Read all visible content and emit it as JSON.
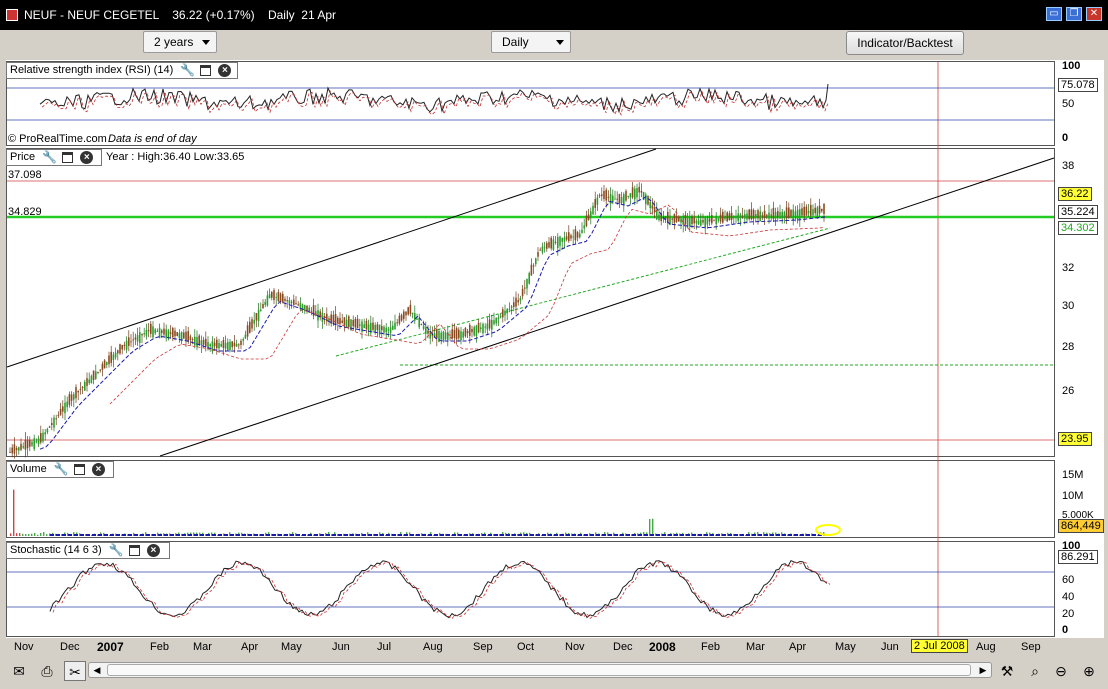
{
  "window": {
    "title": "NEUF - NEUF CEGETEL    36.22 (+0.17%)    Daily  21 Apr",
    "buttons": [
      "▭",
      "❐",
      "✕"
    ]
  },
  "toolbar": {
    "period_select": "2 years",
    "interval_select": "Daily",
    "indicator_button": "Indicator/Backtest"
  },
  "rsi_panel": {
    "header": "Relative strength index (RSI) (14)",
    "y_ticks": [
      "100",
      "50",
      "0"
    ],
    "current_value": "75.078",
    "footer_brand": "© ProRealTime.com",
    "footer_note": "Data is end of day"
  },
  "price_panel": {
    "header": "Price",
    "info": "Year : High:36.40 Low:33.65",
    "y_ticks": [
      "38",
      "36",
      "34",
      "32",
      "30",
      "28",
      "26"
    ],
    "left_labels": [
      "37.098",
      "34.829"
    ],
    "last_price": "36.22",
    "ma_value": "35.224",
    "support_value": "34.302",
    "low_value": "23.95"
  },
  "volume_panel": {
    "header": "Volume",
    "y_ticks": [
      "15M",
      "10M",
      "5.000K"
    ],
    "current_value": "864,449"
  },
  "stochastic_panel": {
    "header": "Stochastic (14 6 3)",
    "y_ticks": [
      "100",
      "80",
      "60",
      "40",
      "20",
      "0"
    ],
    "current_value": "86.291"
  },
  "x_axis": {
    "labels": [
      "Nov",
      "Dec",
      "2007",
      "Feb",
      "Mar",
      "Apr",
      "May",
      "Jun",
      "Jul",
      "Aug",
      "Sep",
      "Oct",
      "Nov",
      "Dec",
      "2008",
      "Feb",
      "Mar",
      "Apr",
      "May",
      "Jun",
      "2 Jul 2008",
      "Aug",
      "Sep"
    ]
  },
  "colors": {
    "support_green": "#22cc22",
    "resistance_red": "#cc3333",
    "highlight_yellow": "#ffff33",
    "accent_blue": "#1a3cff"
  },
  "statusbar": {
    "icons": [
      "mail-icon",
      "print-icon",
      "cut-icon",
      "zoom-icon",
      "zoom-out-icon",
      "zoom-in-icon"
    ]
  }
}
